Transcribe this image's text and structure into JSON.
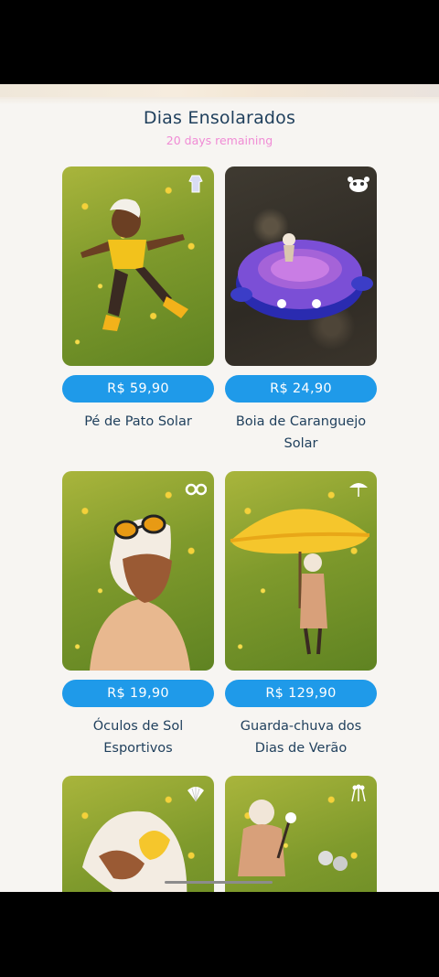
{
  "header": {
    "title": "Dias Ensolarados",
    "subtitle": "20 days remaining"
  },
  "items": [
    {
      "name": "Pé de Pato Solar",
      "price": "R$ 59,90",
      "badge_icon": "outfit-icon"
    },
    {
      "name": "Boia de Caranguejo Solar",
      "price": "R$ 24,90",
      "badge_icon": "crab-icon"
    },
    {
      "name": "Óculos de Sol Esportivos",
      "price": "R$ 19,90",
      "badge_icon": "sunglasses-icon"
    },
    {
      "name": "Guarda-chuva dos Dias de Verão",
      "price": "R$ 129,90",
      "badge_icon": "umbrella-icon"
    },
    {
      "name": "",
      "price": "",
      "badge_icon": "shell-icon"
    },
    {
      "name": "",
      "price": "",
      "badge_icon": "marshmallow-icon"
    }
  ],
  "colors": {
    "price_button": "#1f9ae9",
    "title_text": "#1f3f5c",
    "subtitle_text": "#f08bd5",
    "background": "#f7f5f2"
  }
}
